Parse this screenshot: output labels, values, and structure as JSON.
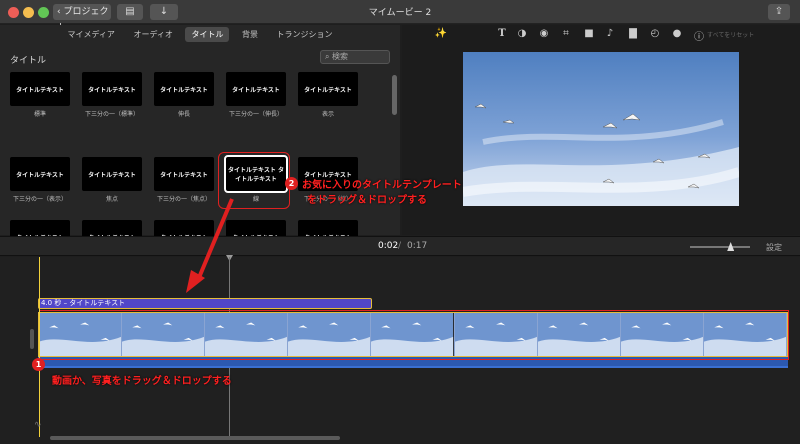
{
  "window": {
    "title": "マイムービー 2",
    "back_label": "プロジェクト",
    "back_icon": "chevron-left-icon",
    "media_icon": "filmstrip-icon",
    "import_icon": "download-arrow-icon",
    "share_icon": "share-icon"
  },
  "browser": {
    "tabs": [
      {
        "label": "マイメディア",
        "active": false
      },
      {
        "label": "オーディオ",
        "active": false
      },
      {
        "label": "タイトル",
        "active": true
      },
      {
        "label": "背景",
        "active": false
      },
      {
        "label": "トランジション",
        "active": false
      }
    ],
    "section_label": "タイトル",
    "search_placeholder": "検索",
    "thumbnails": [
      {
        "text": "タイトルテキスト",
        "caption": "標準"
      },
      {
        "text": "タイトルテキスト",
        "caption": "下三分の一（標準）"
      },
      {
        "text": "タイトルテキスト",
        "caption": "伸長"
      },
      {
        "text": "タイトルテキスト",
        "caption": "下三分の一（伸長）"
      },
      {
        "text": "タイトルテキスト",
        "caption": "表示"
      },
      {
        "text": "タイトルテキスト",
        "caption": "下三分の一（表示）"
      },
      {
        "text": "タイトルテキスト",
        "caption": "焦点"
      },
      {
        "text": "タイトルテキスト",
        "caption": "下三分の一（焦点）"
      },
      {
        "text": "タイトルテキスト タイトルテキスト",
        "caption": "線",
        "selected": true
      },
      {
        "text": "タイトルテキスト",
        "caption": "下三分の一（線）"
      },
      {
        "text": "タイトルテキスト",
        "caption": ""
      },
      {
        "text": "タイトルテキスト",
        "caption": ""
      },
      {
        "text": "タイトルテキスト",
        "caption": ""
      },
      {
        "text": "タイトルテキスト",
        "caption": ""
      },
      {
        "text": "タイトルテキスト",
        "caption": ""
      }
    ]
  },
  "viewer": {
    "reset_label": "すべてをリセット",
    "tools": [
      "magic-wand-icon",
      "text-icon",
      "color-balance-icon",
      "palette-icon",
      "crop-icon",
      "camera-icon",
      "volume-icon",
      "equalizer-icon",
      "speed-icon",
      "filter-icon",
      "info-icon"
    ]
  },
  "transport": {
    "current_time": "0:02",
    "separator": "/",
    "total_time": "0:17",
    "zoom_level": 0.67,
    "settings_label": "設定"
  },
  "timeline": {
    "title_clip_label": "4.0 秒 – タイトルテキスト",
    "frame_count": 9
  },
  "annotations": {
    "step2_number": "2",
    "step2_line1": "お気に入りのタイトルテンプレート",
    "step2_line2": "をドラッグ＆ドロップする",
    "step1_number": "1",
    "step1_text": "動画か、写真をドラッグ＆ドロップする",
    "accent_color": "#e02020"
  }
}
